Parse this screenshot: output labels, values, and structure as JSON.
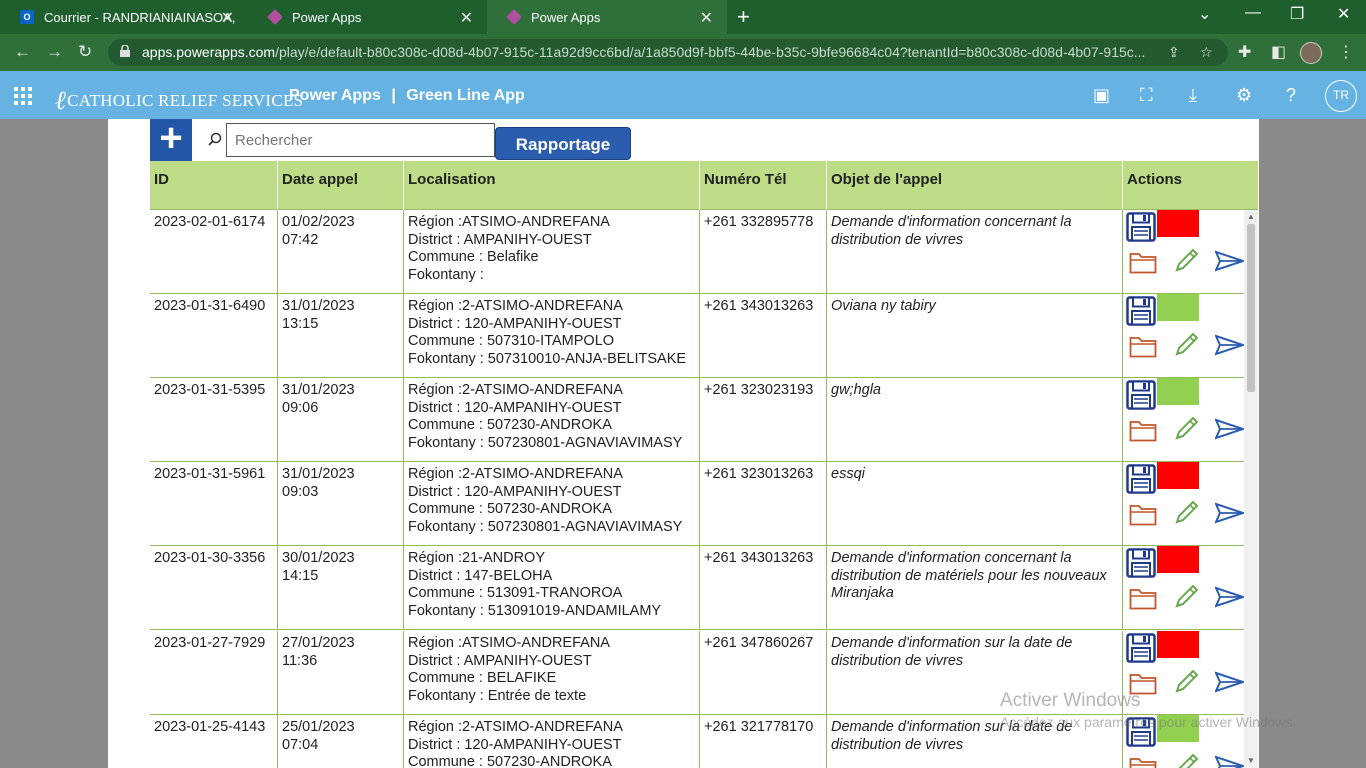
{
  "browser": {
    "tabs": [
      {
        "label": "Courrier - RANDRIANIAINASOA,",
        "active": false
      },
      {
        "label": "Power Apps",
        "active": false
      },
      {
        "label": "Power Apps",
        "active": true
      }
    ],
    "url_domain": "apps.powerapps.com",
    "url_path": "/play/e/default-b80c308c-d08d-4b07-915c-11a92d9cc6bd/a/1a850d9f-bbf5-44be-b35c-9bfe96684c04?tenantId=b80c308c-d08d-4b07-915c..."
  },
  "header": {
    "org_logo": "CATHOLIC RELIEF SERVICES",
    "product": "Power Apps",
    "separator": "|",
    "app_name": "Green Line App",
    "user_initials": "TR"
  },
  "toolbar": {
    "add_label": "+",
    "search_placeholder": "Rechercher",
    "report_label": "Rapportage"
  },
  "table": {
    "columns": [
      "ID",
      "Date appel",
      "Localisation",
      "Numéro Tél",
      "Objet de l'appel",
      "Actions"
    ],
    "rows": [
      {
        "id": "2023-02-01-6174",
        "date": "01/02/2023",
        "time": "07:42",
        "region": "Région :ATSIMO-ANDREFANA",
        "district": "District : AMPANIHY-OUEST",
        "commune": "Commune : Belafike",
        "fokontany": "Fokontany :",
        "phone": "+261 332895778",
        "subject": "Demande d'information concernant la distribution de vivres",
        "status_color": "#ff0000"
      },
      {
        "id": "2023-01-31-6490",
        "date": "31/01/2023",
        "time": "13:15",
        "region": "Région :2-ATSIMO-ANDREFANA",
        "district": "District : 120-AMPANIHY-OUEST",
        "commune": "Commune : 507310-ITAMPOLO",
        "fokontany": "Fokontany : 507310010-ANJA-BELITSAKE",
        "phone": "+261 343013263",
        "subject": "Oviana ny tabiry",
        "status_color": "#92d050"
      },
      {
        "id": "2023-01-31-5395",
        "date": "31/01/2023",
        "time": "09:06",
        "region": "Région :2-ATSIMO-ANDREFANA",
        "district": "District : 120-AMPANIHY-OUEST",
        "commune": "Commune : 507230-ANDROKA",
        "fokontany": "Fokontany : 507230801-AGNAVIAVIMASY",
        "phone": "+261 323023193",
        "subject": "gw;hgla",
        "status_color": "#92d050"
      },
      {
        "id": "2023-01-31-5961",
        "date": "31/01/2023",
        "time": "09:03",
        "region": "Région :2-ATSIMO-ANDREFANA",
        "district": "District : 120-AMPANIHY-OUEST",
        "commune": "Commune : 507230-ANDROKA",
        "fokontany": "Fokontany : 507230801-AGNAVIAVIMASY",
        "phone": "+261 323013263",
        "subject": "essqi",
        "status_color": "#ff0000"
      },
      {
        "id": "2023-01-30-3356",
        "date": "30/01/2023",
        "time": "14:15",
        "region": "Région :21-ANDROY",
        "district": "District : 147-BELOHA",
        "commune": "Commune : 513091-TRANOROA",
        "fokontany": "Fokontany : 513091019-ANDAMILAMY",
        "phone": "+261 343013263",
        "subject": "Demande d'information concernant la distribution de matériels pour les nouveaux Miranjaka",
        "status_color": "#ff0000"
      },
      {
        "id": "2023-01-27-7929",
        "date": "27/01/2023",
        "time": "11:36",
        "region": "Région :ATSIMO-ANDREFANA",
        "district": "District : AMPANIHY-OUEST",
        "commune": "Commune : BELAFIKE",
        "fokontany": "Fokontany : Entrée de texte",
        "phone": "+261 347860267",
        "subject": "Demande d'information sur la date de distribution de vivres",
        "status_color": "#ff0000"
      },
      {
        "id": "2023-01-25-4143",
        "date": "25/01/2023",
        "time": "07:04",
        "region": "Région :2-ATSIMO-ANDREFANA",
        "district": "District : 120-AMPANIHY-OUEST",
        "commune": "Commune : 507230-ANDROKA",
        "fokontany": "",
        "phone": "+261 321778170",
        "subject": "Demande d'information sur la date de distribution de vivres",
        "status_color": "#92d050"
      }
    ]
  },
  "watermark": {
    "line1": "Activer Windows",
    "line2": "Accédez aux paramètres pour activer Windows."
  }
}
